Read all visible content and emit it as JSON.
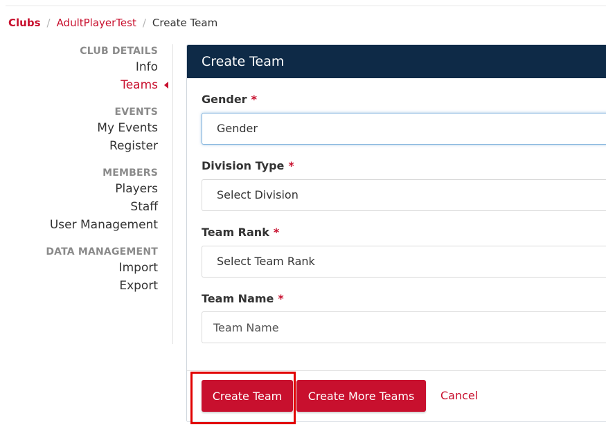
{
  "breadcrumb": {
    "root": "Clubs",
    "club": "AdultPlayerTest",
    "current": "Create Team",
    "separator": "/"
  },
  "sidebar": {
    "sections": [
      {
        "title": "CLUB DETAILS",
        "items": [
          {
            "label": "Info",
            "active": false
          },
          {
            "label": "Teams",
            "active": true
          }
        ]
      },
      {
        "title": "EVENTS",
        "items": [
          {
            "label": "My Events",
            "active": false
          },
          {
            "label": "Register",
            "active": false
          }
        ]
      },
      {
        "title": "MEMBERS",
        "items": [
          {
            "label": "Players",
            "active": false
          },
          {
            "label": "Staff",
            "active": false
          },
          {
            "label": "User Management",
            "active": false
          }
        ]
      },
      {
        "title": "DATA MANAGEMENT",
        "items": [
          {
            "label": "Import",
            "active": false
          },
          {
            "label": "Export",
            "active": false
          }
        ]
      }
    ]
  },
  "form": {
    "title": "Create Team",
    "required_marker": "*",
    "fields": {
      "gender": {
        "label": "Gender",
        "value": "Gender"
      },
      "division": {
        "label": "Division Type",
        "value": "Select Division"
      },
      "rank": {
        "label": "Team Rank",
        "value": "Select Team Rank"
      },
      "name": {
        "label": "Team Name",
        "placeholder": "Team Name",
        "value": ""
      }
    },
    "buttons": {
      "create": "Create Team",
      "create_more": "Create More Teams",
      "cancel": "Cancel"
    }
  },
  "colors": {
    "accent": "#c8102e",
    "header_bg": "#0e2a47",
    "highlight": "#e10000"
  }
}
